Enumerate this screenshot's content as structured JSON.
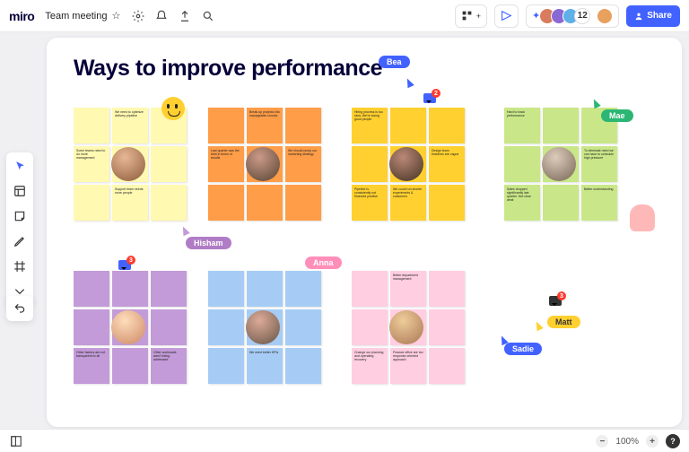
{
  "app": {
    "logo": "miro"
  },
  "header": {
    "board_name": "Team meeting",
    "participant_count": "12",
    "share_label": "Share"
  },
  "canvas": {
    "title": "Ways to improve performance"
  },
  "collaborators": {
    "bea": "Bea",
    "mae": "Mae",
    "hisham": "Hisham",
    "anna": "Anna",
    "matt": "Matt",
    "sadie": "Sadie"
  },
  "comments": {
    "c1": "2",
    "c2": "3",
    "c3": "3"
  },
  "clusters": {
    "yellow": [
      "",
      "We need to optimize delivery pipeline",
      "",
      "Some teams need to do more management",
      "",
      "",
      "",
      "Support team needs more people",
      ""
    ],
    "orange": [
      "",
      "Break up projects into manageable chunks",
      "",
      "Last quarter was the best in terms of results",
      "",
      "We should pump our marketing strategy",
      "",
      "",
      ""
    ],
    "gold": [
      "Hiring process is too slow. We're losing good people",
      "",
      "",
      "",
      "",
      "Design team timelines are vague",
      "Pipeline is consistently not financed positive",
      "We could run shorter experiments & customers",
      ""
    ],
    "green": [
      "Hard to track performance",
      "",
      "",
      "",
      "",
      "To eliminate need we can have to schedule high pressure",
      "Sales dropped significantly last quarter. Not clear what",
      "",
      "Better understanding"
    ],
    "purple": [
      "",
      "",
      "",
      "",
      "",
      "",
      "Other factors are not transparent to all",
      "",
      "Other workloads aren't being addressed"
    ],
    "blue": [
      "",
      "",
      "",
      "",
      "",
      "",
      "",
      "We need better KPIs",
      ""
    ],
    "pink": [
      "",
      "Better department management",
      "",
      "",
      "",
      "",
      "Change our planning and operating recovery",
      "Finance office are too response oriented approach",
      ""
    ]
  },
  "footer": {
    "zoom": "100%",
    "help": "?"
  }
}
